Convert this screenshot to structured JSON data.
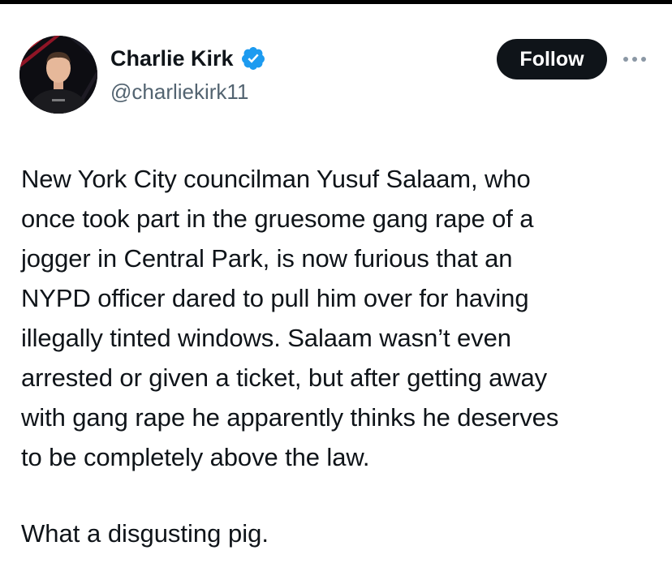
{
  "author": {
    "display_name": "Charlie Kirk",
    "handle": "@charliekirk11",
    "verified": true
  },
  "actions": {
    "follow_label": "Follow",
    "more_icon": "more-horizontal-icon"
  },
  "tweet": {
    "text": "New York City councilman Yusuf Salaam, who\nonce took part in the gruesome gang rape of a\njogger in Central Park, is now furious that an\nNYPD officer dared to pull him over for having\nillegally tinted windows. Salaam wasn’t even\narrested or given a ticket, but after getting away\nwith gang rape he apparently thinks he deserves\nto be completely above the law.",
    "closing": "What a disgusting pig."
  },
  "colors": {
    "text_primary": "#0f1419",
    "text_secondary": "#536471",
    "verified_blue": "#1d9bf0",
    "follow_bg": "#0f1419",
    "follow_text": "#ffffff"
  }
}
